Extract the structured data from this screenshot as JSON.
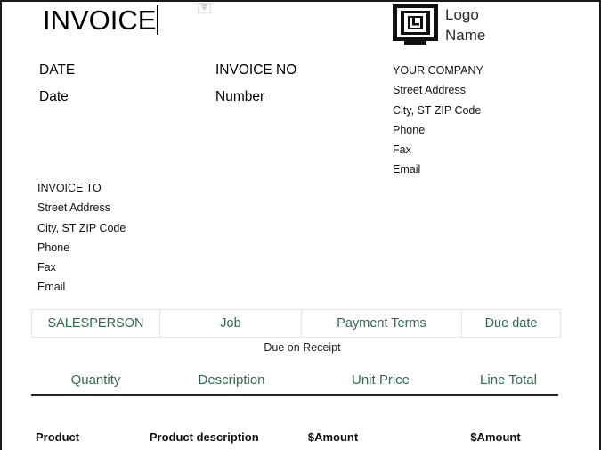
{
  "document": {
    "title": "INVOICE",
    "has_text_caret": true
  },
  "marker": {
    "icon": "dropdown-marker-icon"
  },
  "logo": {
    "icon": "maze-square-logo-icon",
    "line1": "Logo",
    "line2": "Name"
  },
  "meta": {
    "date_label": "DATE",
    "date_value": "Date",
    "invoice_no_label": "INVOICE NO",
    "invoice_no_value": "Number"
  },
  "company": {
    "heading": "YOUR COMPANY",
    "lines": [
      "Street Address",
      "City, ST ZIP Code",
      "Phone",
      "Fax",
      "Email"
    ]
  },
  "bill_to": {
    "heading": "INVOICE TO",
    "lines": [
      "Street Address",
      "City, ST ZIP Code",
      "Phone",
      "Fax",
      "Email"
    ]
  },
  "terms_table": {
    "headers": [
      "SALESPERSON",
      "Job",
      "Payment Terms",
      "Due date"
    ],
    "note": "Due on Receipt"
  },
  "line_items": {
    "headers": [
      "Quantity",
      "Description",
      "Unit Price",
      "Line Total"
    ],
    "rows": [
      {
        "quantity": "Product",
        "description": "Product description",
        "unit_price": "$Amount",
        "line_total": "$Amount"
      }
    ]
  },
  "colors": {
    "accent_green": "#2e6b4c",
    "text_black": "#000000",
    "rule_dark": "#262626",
    "cell_border": "#e4e4e4"
  }
}
